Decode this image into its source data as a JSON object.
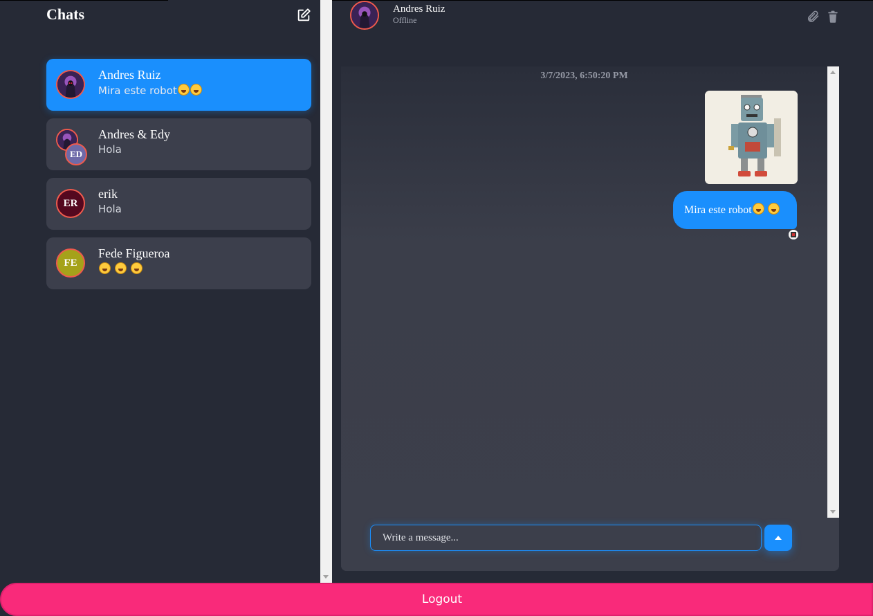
{
  "sidebar": {
    "title": "Chats",
    "compose_icon": "compose-icon",
    "chats": [
      {
        "name": "Andres Ruiz",
        "preview": "Mira este robot",
        "preview_emojis": 2,
        "avatar": "image",
        "active": true
      },
      {
        "name": "Andres & Edy",
        "preview": "Hola",
        "avatar_initials": "ED",
        "avatar": "group"
      },
      {
        "name": "erik",
        "preview": "Hola",
        "avatar_initials": "ER",
        "avatar_color": "#54081f"
      },
      {
        "name": "Fede Figueroa",
        "preview": "",
        "preview_emojis": 3,
        "avatar_initials": "FE",
        "avatar_color": "#a5a21a"
      }
    ]
  },
  "conversation": {
    "contact_name": "Andres Ruiz",
    "contact_status": "Offline",
    "attach_icon": "paperclip-icon",
    "delete_icon": "trash-icon",
    "timestamp": "3/7/2023, 6:50:20 PM",
    "messages": [
      {
        "type": "image",
        "alt": "robot toy"
      },
      {
        "type": "text",
        "text": "Mira este robot",
        "emojis": 2
      }
    ],
    "input_placeholder": "Write a message...",
    "send_icon": "send-arrow-icon"
  },
  "logout_label": "Logout",
  "colors": {
    "accent": "#1a8ffd",
    "logout": "#f92a7a",
    "background": "#262a36",
    "card": "#3c3f4c",
    "avatar_ring": "#ef5a4d"
  }
}
